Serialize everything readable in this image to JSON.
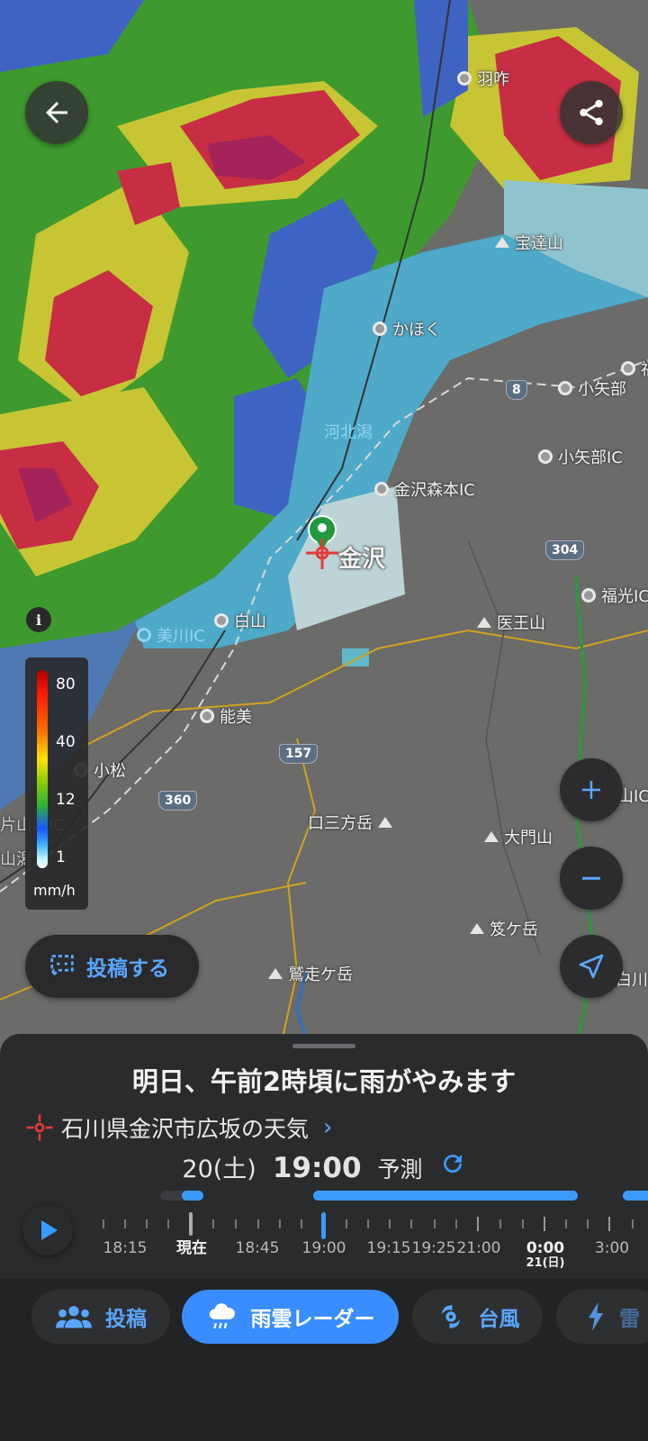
{
  "map": {
    "places": {
      "hakui": "羽咋",
      "hodatsusan": "宝達山",
      "kahoku": "かほく",
      "oyabe": "小矢部",
      "oyabe_ic": "小矢部IC",
      "kahokugata": "河北潟",
      "kanazawa_morimoto_ic": "金沢森本IC",
      "kanazawa": "金沢",
      "fukumitsu_ic": "福光IC",
      "iozen": "医王山",
      "mikawa_ic": "美川IC",
      "hakusan": "白山",
      "nomi": "能美",
      "komatsu": "小松",
      "katayamazu_ic": "片山津IC",
      "kuchisanpo": "口三方岳",
      "okadosan": "大門山",
      "okatagatake": "笈ケ岳",
      "sagisotake": "鷲走ケ岳",
      "shirakawa": "白川",
      "yamashiro": "山潟",
      "fuku_ic_edge": "山IC",
      "edge_right": "福"
    },
    "roads": {
      "r8": "8",
      "r304": "304",
      "r157": "157",
      "r360": "360"
    },
    "info_icon": "i",
    "legend": {
      "ticks": [
        "80",
        "40",
        "12",
        "1"
      ],
      "unit": "mm/h"
    },
    "post_button": "投稿する"
  },
  "sheet": {
    "headline": "明日、午前2時頃に雨がやみます",
    "location": "石川県金沢市広坂の天気",
    "date": "20(土)",
    "time": "19:00",
    "forecast_label": "予測"
  },
  "timeline": {
    "labels": [
      "18:15",
      "現在",
      "18:45",
      "19:00",
      "19:15",
      "19:25",
      "21:00",
      "0:00",
      "3:00"
    ],
    "sub_label": "21(日)"
  },
  "nav": {
    "tabs": [
      "投稿",
      "雨雲レーダー",
      "台風",
      "雷"
    ]
  },
  "colors": {
    "accent": "#3a8dff",
    "sheet_bg": "#2a2b2d"
  }
}
